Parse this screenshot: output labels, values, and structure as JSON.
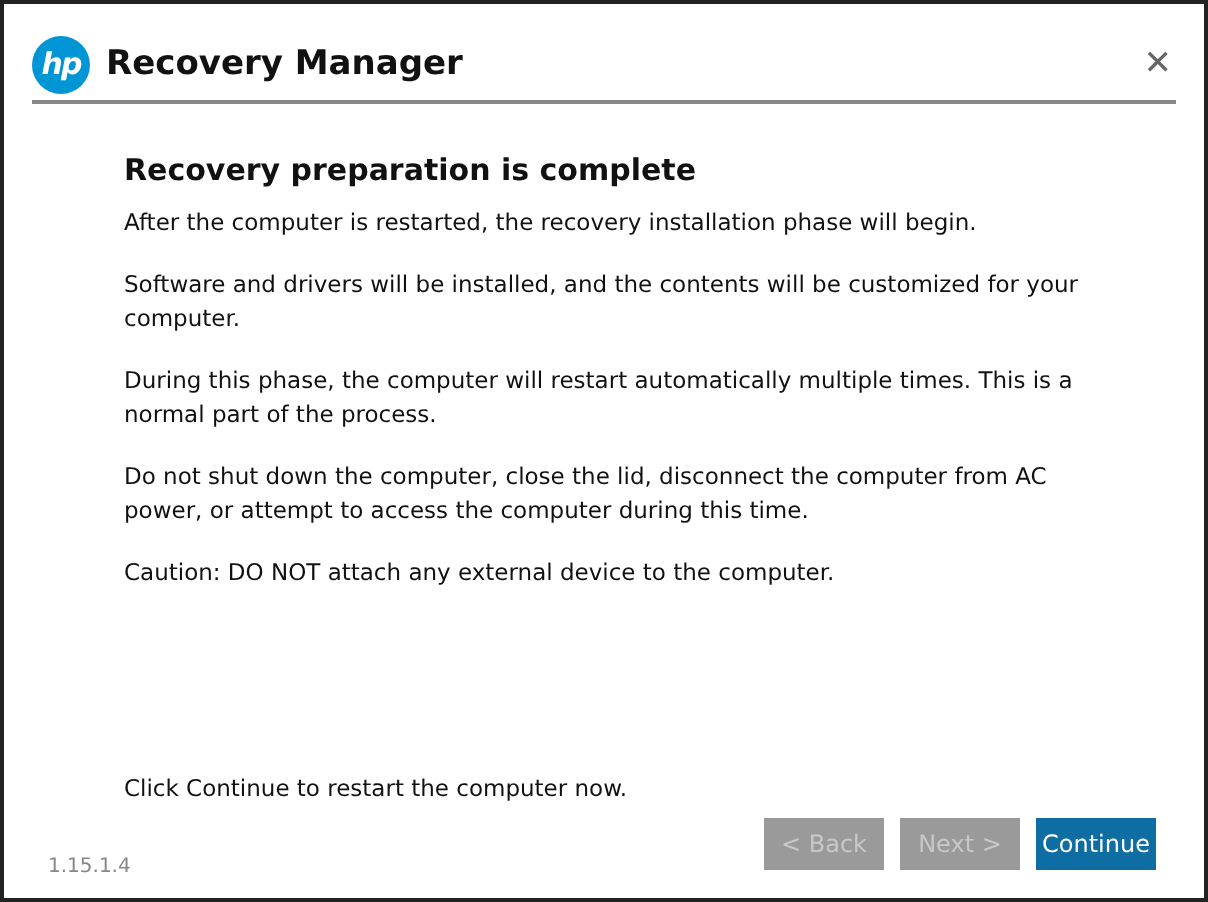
{
  "window": {
    "logo": "hp",
    "title": "Recovery Manager",
    "close": "✕"
  },
  "heading": "Recovery preparation is complete",
  "paragraphs": [
    "After the computer is restarted, the recovery installation phase will begin.",
    "Software and drivers will be installed, and the contents will be customized for your computer.",
    "During this phase, the computer will restart automatically multiple times. This is a normal part of the process.",
    "Do not shut down the computer, close the lid, disconnect the computer from AC power, or attempt to access the computer during this time.",
    "Caution: DO NOT attach any external device to the computer."
  ],
  "prompt": "Click Continue to restart the computer now.",
  "buttons": [
    {
      "label": "< Back",
      "kind": "secondary",
      "disabled": true
    },
    {
      "label": "Next >",
      "kind": "secondary",
      "disabled": true
    },
    {
      "label": "Continue",
      "kind": "primary",
      "disabled": false
    }
  ],
  "version": "1.15.1.4"
}
